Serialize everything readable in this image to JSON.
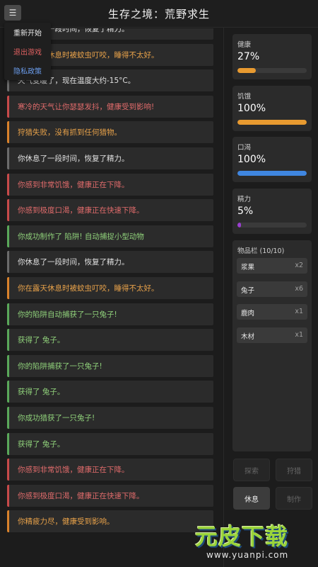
{
  "header": {
    "title": "生存之境：荒野求生",
    "menu_icon": "☰"
  },
  "menu": {
    "items": [
      {
        "label": "重新开始",
        "color": "#e8e8e8"
      },
      {
        "label": "退出游戏",
        "color": "#e06060"
      },
      {
        "label": "隐私政策",
        "color": "#6a9bea"
      }
    ]
  },
  "log": [
    {
      "text": "你休息了一段时间，恢复了精力。",
      "type": "neutral"
    },
    {
      "text": "你在露天休息时被蚊虫叮咬，睡得不太好。",
      "type": "warn"
    },
    {
      "text": "天气变暖了，现在温度大约-15°C。",
      "type": "neutral"
    },
    {
      "text": "寒冷的天气让你瑟瑟发抖，健康受到影响!",
      "type": "bad"
    },
    {
      "text": "狩猎失败，没有抓到任何猎物。",
      "type": "warn"
    },
    {
      "text": "你休息了一段时间，恢复了精力。",
      "type": "neutral"
    },
    {
      "text": "你感到非常饥饿，健康正在下降。",
      "type": "bad"
    },
    {
      "text": "你感到极度口渴，健康正在快速下降。",
      "type": "bad"
    },
    {
      "text": "你成功制作了 陷阱! 自动捕捉小型动物",
      "type": "good"
    },
    {
      "text": "你休息了一段时间，恢复了精力。",
      "type": "neutral"
    },
    {
      "text": "你在露天休息时被蚊虫叮咬，睡得不太好。",
      "type": "warn"
    },
    {
      "text": "你的陷阱自动捕获了一只兔子!",
      "type": "good"
    },
    {
      "text": "获得了 兔子。",
      "type": "good"
    },
    {
      "text": "你的陷阱捕获了一只兔子!",
      "type": "good"
    },
    {
      "text": "获得了 兔子。",
      "type": "good"
    },
    {
      "text": "你成功猎获了一只兔子!",
      "type": "good"
    },
    {
      "text": "获得了 兔子。",
      "type": "good"
    },
    {
      "text": "你感到非常饥饿，健康正在下降。",
      "type": "bad"
    },
    {
      "text": "你感到极度口渴，健康正在快速下降。",
      "type": "bad"
    },
    {
      "text": "你精疲力尽，健康受到影响。",
      "type": "warn"
    }
  ],
  "stats": [
    {
      "key": "health",
      "label": "健康",
      "value": "27%",
      "level": 0.27,
      "color": "#e89a30"
    },
    {
      "key": "hunger",
      "label": "饥饿",
      "value": "100%",
      "level": 1.0,
      "color": "#e89a30"
    },
    {
      "key": "thirst",
      "label": "口渴",
      "value": "100%",
      "level": 1.0,
      "color": "#3f86e0"
    },
    {
      "key": "energy",
      "label": "精力",
      "value": "5%",
      "level": 0.05,
      "color": "#9b3fd0"
    }
  ],
  "inventory": {
    "title": "物品栏 (10/10)",
    "items": [
      {
        "name": "浆果",
        "qty": "x2"
      },
      {
        "name": "兔子",
        "qty": "x6"
      },
      {
        "name": "鹿肉",
        "qty": "x1"
      },
      {
        "name": "木材",
        "qty": "x1"
      }
    ]
  },
  "actions": [
    {
      "key": "explore",
      "label": "探索",
      "enabled": false
    },
    {
      "key": "hunt",
      "label": "狩猎",
      "enabled": false
    },
    {
      "key": "rest",
      "label": "休息",
      "enabled": true
    },
    {
      "key": "craft",
      "label": "制作",
      "enabled": false
    }
  ],
  "watermark": {
    "brand": "元皮下载",
    "url": "www.yuanpi.com"
  }
}
